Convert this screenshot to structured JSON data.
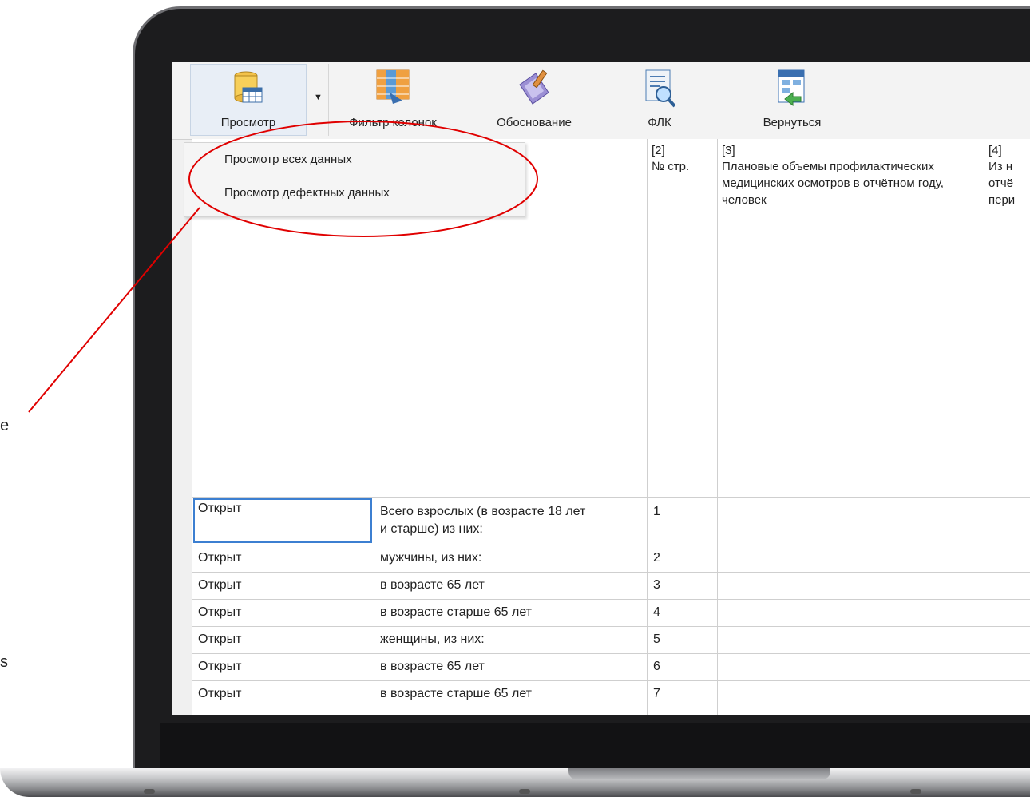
{
  "toolbar": {
    "buttons": [
      {
        "label": "Просмотр",
        "icon": "database-view-icon"
      },
      {
        "label": "Фильтр колонок",
        "icon": "column-filter-icon"
      },
      {
        "label": "Обоснование",
        "icon": "justification-icon"
      },
      {
        "label": "ФЛК",
        "icon": "flk-check-icon"
      },
      {
        "label": "Вернуться",
        "icon": "return-icon"
      }
    ]
  },
  "menu": {
    "items": [
      "Просмотр всех данных",
      "Просмотр дефектных данных"
    ]
  },
  "table": {
    "headers": {
      "col2_num": "[2]",
      "col2_name": "№ стр.",
      "col3_num": "[3]",
      "col3_name": "Плановые объемы профилактических медицинских осмотров в отчётном году, человек",
      "col4_num": "[4]",
      "col4_name_l1": "Из н",
      "col4_name_l2": "отчё",
      "col4_name_l3": "пери"
    },
    "rows": [
      {
        "status": "Открыт",
        "name": "Всего взрослых (в возрасте 18 лет",
        "name2": "и старше) из них:",
        "num": "1"
      },
      {
        "status": "Открыт",
        "name": "мужчины, из них:",
        "num": "2"
      },
      {
        "status": "Открыт",
        "name": "в возрасте 65 лет",
        "num": "3"
      },
      {
        "status": "Открыт",
        "name": "в возрасте старше 65 лет",
        "num": "4"
      },
      {
        "status": "Открыт",
        "name": "женщины, из них:",
        "num": "5"
      },
      {
        "status": "Открыт",
        "name": "в возрасте 65 лет",
        "num": "6"
      },
      {
        "status": "Открыт",
        "name": "в возрасте старше 65 лет",
        "num": "7"
      }
    ]
  },
  "stray": [
    "e",
    "s"
  ],
  "colors": {
    "annotation": "#e00000",
    "selection": "#3c7fd1"
  }
}
